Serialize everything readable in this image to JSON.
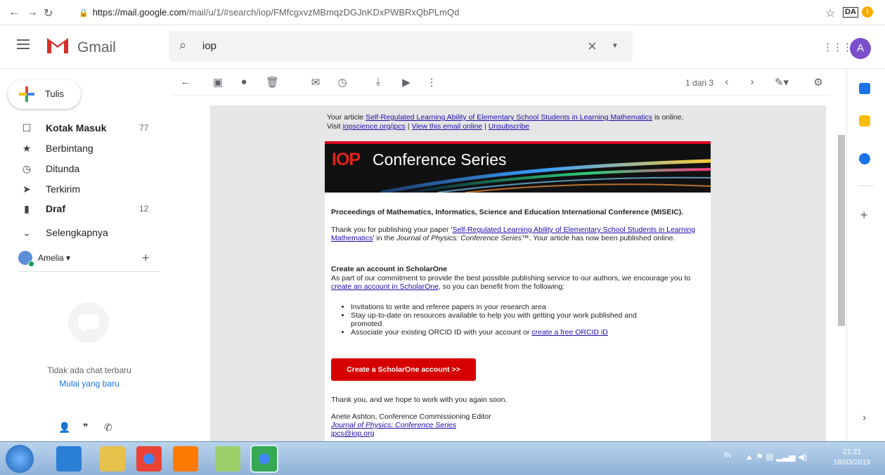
{
  "browser": {
    "url_host": "https://mail.google.com",
    "url_path": "/mail/u/1/#search/iop/FMfcgxvzMBmqzDGJnKDxPWBRxQbPLmQd",
    "ext_da": "DA",
    "ext_warn": "!"
  },
  "header": {
    "brand": "Gmail",
    "search_value": "iop",
    "avatar_letter": "A"
  },
  "sidebar": {
    "compose_label": "Tulis",
    "items": [
      {
        "label": "Kotak Masuk",
        "count": "77",
        "icon": "inbox-icon"
      },
      {
        "label": "Berbintang",
        "count": "",
        "icon": "star-icon"
      },
      {
        "label": "Ditunda",
        "count": "",
        "icon": "clock-icon"
      },
      {
        "label": "Terkirim",
        "count": "",
        "icon": "send-icon"
      },
      {
        "label": "Draf",
        "count": "12",
        "icon": "draft-icon"
      },
      {
        "label": "Selengkapnya",
        "count": "",
        "icon": "chevron-down-icon"
      }
    ],
    "account_name": "Amelia",
    "chat_empty": "Tidak ada chat terbaru",
    "chat_start": "Mulai yang baru"
  },
  "toolbar": {
    "pager": "1 dari 3"
  },
  "email": {
    "intro_pre": "Your article ",
    "intro_link": "Self-Regulated Learning Ability of Elementary School Students in Learning Mathematics",
    "intro_post": " is online.",
    "visit": "Visit ",
    "link_iopscience": "iopscience.org/jpcs",
    "link_view": "View this email online",
    "link_unsub": "Unsubscribe",
    "banner_iop": "IOP",
    "banner_series": "Conference Series",
    "conf_title": "Proceedings of Mathematics, Informatics, Science and Education International Conference (MISEIC).",
    "thank_pre": "Thank you for publishing your paper '",
    "thank_link": "Self-Regulated Learning Ability of Elementary School Students in Learning Mathematics",
    "thank_mid": "' in the ",
    "thank_journal": "Journal of Physics: Conference Series™",
    "thank_post": ". Your article has now been published online.",
    "create_head": "Create an account in ScholarOne",
    "create_p1": "As part of our commitment to provide the best possible publishing service to our authors, we encourage you to ",
    "create_link": "create an account in ScholarOne",
    "create_p2": ", so you can benefit from the following:",
    "bullets": [
      "Invitations to write and referee papers in your research area",
      "Stay up-to-date on resources available to help you with getting your work published and promoted",
      "Associate your existing ORCID ID with your account or "
    ],
    "orcid_link": "create a free ORCID iD",
    "button": "Create a ScholarOne account >>",
    "closing": "Thank you, and we hope to work with you again soon.",
    "sig_name": "Anete Ashton, Conference Commissioning Editor",
    "sig_journal": "Journal of Physics: Conference Series",
    "sig_email": "jpcs@iop.org"
  },
  "taskbar": {
    "tray_lang": "IN",
    "time": "21:21",
    "date": "18/03/2019"
  }
}
